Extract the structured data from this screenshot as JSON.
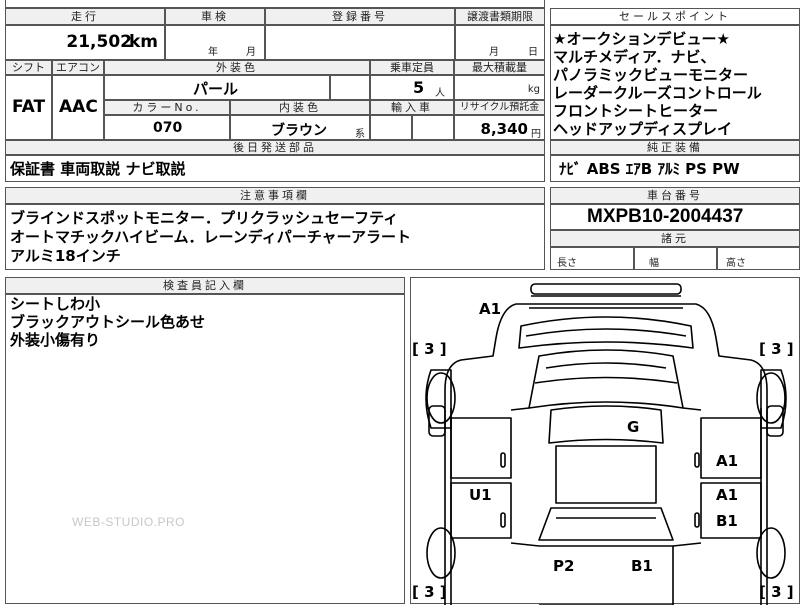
{
  "top_row": {
    "mileage_label": "走行",
    "inspection_label": "車検",
    "registration_label": "登録番号",
    "transfer_deadline_label": "譲渡書類期限",
    "mileage_value": "21,502",
    "mileage_unit": "km",
    "year_label": "年",
    "month_label": "月",
    "transfer_month_label": "月",
    "transfer_day_label": "日"
  },
  "spec_row": {
    "shift_label": "シフト",
    "aircon_label": "エアコン",
    "exterior_color_label": "外装色",
    "capacity_label": "乗車定員",
    "max_load_label": "最大積載量",
    "shift_value": "FAT",
    "aircon_value": "AAC",
    "exterior_color_value": "パール",
    "capacity_value": "5",
    "capacity_unit": "人",
    "load_unit": "kg",
    "color_no_label": "カラーNo.",
    "interior_color_label": "内装色",
    "import_label": "輸入車",
    "recycle_label": "リサイクル預託金",
    "color_no_value": "070",
    "interior_color_value": "ブラウン",
    "interior_suffix": "系",
    "recycle_value": "8,340",
    "recycle_unit": "円"
  },
  "deferred_parts": {
    "label": "後日発送部品",
    "value": "保証書 車両取説 ナビ取説"
  },
  "notes": {
    "label": "注意事項欄",
    "lines": [
      "ブラインドスポットモニター．プリクラッシュセーフティ",
      "オートマチックハイビーム．レーンディパーチャーアラート",
      "アルミ18インチ"
    ]
  },
  "inspector": {
    "label": "検査員記入欄",
    "lines": [
      "シートしわ小",
      "ブラックアウトシール色あせ",
      "外装小傷有り"
    ]
  },
  "sales_points": {
    "label": "セールスポイント",
    "lines": [
      "★オークションデビュー★",
      "マルチメディア．ナビ、",
      "パノラミックビューモニター",
      "レーダークルーズコントロール",
      "フロントシートヒーター",
      "ヘッドアップディスプレイ"
    ]
  },
  "genuine_equipment": {
    "label": "純正装備",
    "value": "ﾅﾋﾞ ABS ｴｱB ｱﾙﾐ PS PW"
  },
  "chassis": {
    "label": "車台番号",
    "value": "MXPB10-2004437"
  },
  "dimensions": {
    "label": "諸元",
    "length_label": "長さ",
    "width_label": "幅",
    "height_label": "高さ"
  },
  "diagram": {
    "marks": {
      "a1_top": "A1",
      "g": "G",
      "a1_right_upper": "A1",
      "a1_right_mid": "A1",
      "b1_right": "B1",
      "u1": "U1",
      "p2": "P2",
      "b1_bottom": "B1"
    },
    "tires": {
      "front_left": "[ 3 ]",
      "front_right": "[ 3 ]",
      "rear_left": "[ 3 ]",
      "rear_right": "[ 3 ]"
    }
  },
  "watermark": "WEB-STUDIO.PRO"
}
